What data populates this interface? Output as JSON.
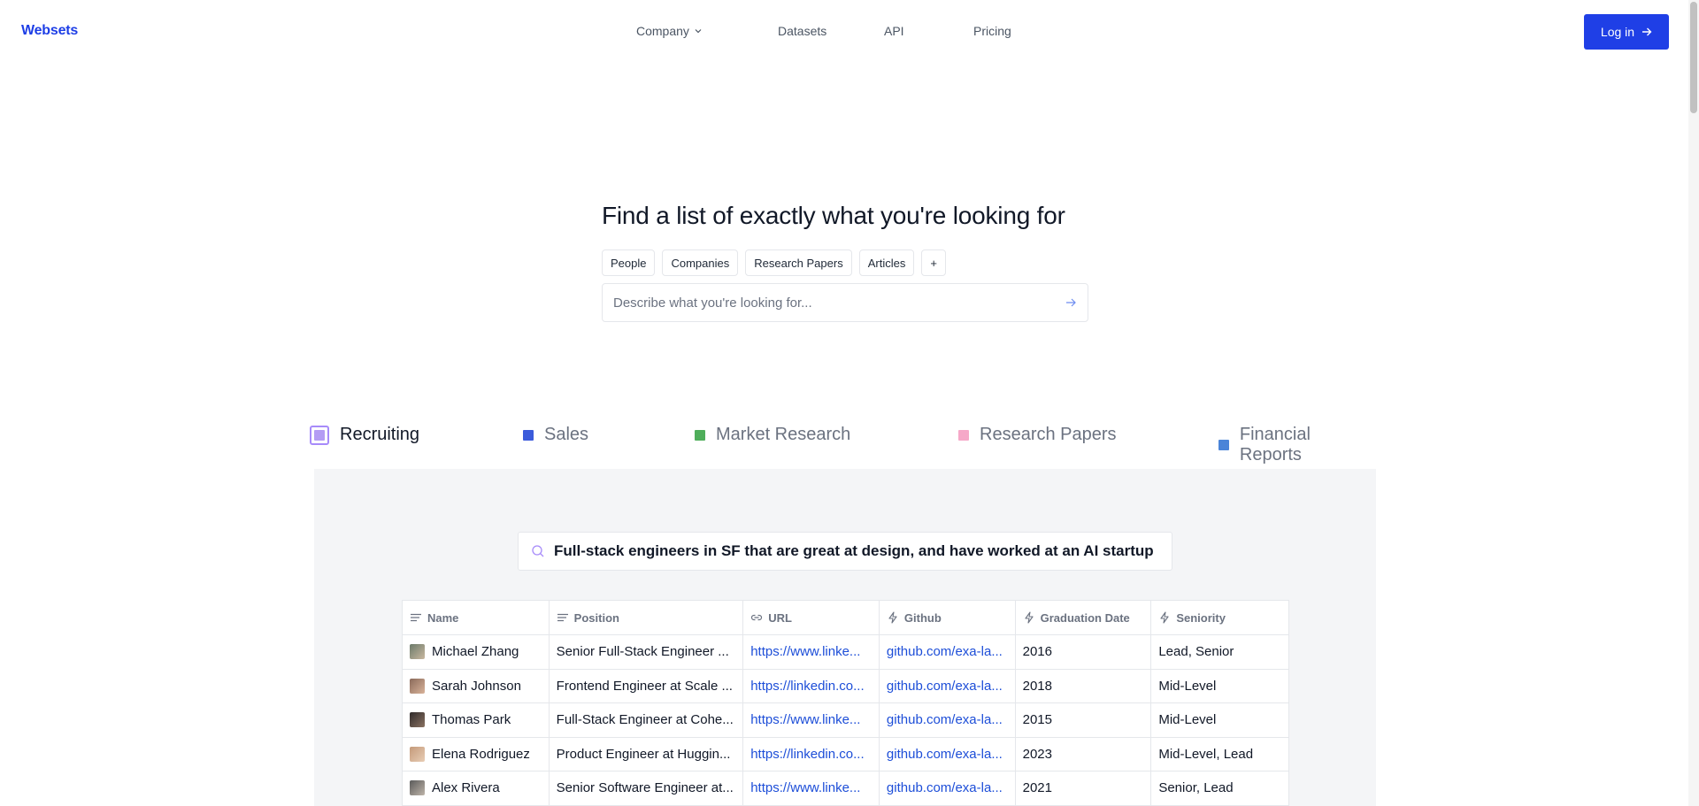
{
  "nav": {
    "logo": "Websets",
    "links": [
      {
        "label": "Company",
        "has_dropdown": true
      },
      {
        "label": "Datasets"
      },
      {
        "label": "API"
      },
      {
        "label": "Pricing"
      }
    ],
    "login_label": "Log in"
  },
  "hero": {
    "title": "Find a list of exactly what you're looking for",
    "chips": [
      "People",
      "Companies",
      "Research Papers",
      "Articles",
      "+"
    ],
    "search_placeholder": "Describe what you're looking for..."
  },
  "tabs": [
    {
      "label": "Recruiting",
      "color": "#b49cf4",
      "active": true
    },
    {
      "label": "Sales",
      "color": "#3b5bdb"
    },
    {
      "label": "Market Research",
      "color": "#4fae5b"
    },
    {
      "label": "Research Papers",
      "color": "#f6a8c8"
    },
    {
      "label": "Financial Reports",
      "color": "#4a84d8"
    }
  ],
  "demo": {
    "query": "Full-stack engineers in SF that are great at design, and have worked at an AI startup",
    "columns": [
      {
        "label": "Name",
        "icon": "text-lines-icon"
      },
      {
        "label": "Position",
        "icon": "text-lines-icon"
      },
      {
        "label": "URL",
        "icon": "link-icon"
      },
      {
        "label": "Github",
        "icon": "bolt-icon"
      },
      {
        "label": "Graduation Date",
        "icon": "bolt-icon"
      },
      {
        "label": "Seniority",
        "icon": "bolt-icon"
      }
    ],
    "rows": [
      {
        "name": "Michael Zhang",
        "position": "Senior Full-Stack Engineer ...",
        "url": "https://www.linke...",
        "github": "github.com/exa-la...",
        "graduation": "2016",
        "seniority": "Lead, Senior"
      },
      {
        "name": "Sarah Johnson",
        "position": "Frontend Engineer at Scale ...",
        "url": "https://linkedin.co...",
        "github": "github.com/exa-la...",
        "graduation": "2018",
        "seniority": "Mid-Level"
      },
      {
        "name": "Thomas Park",
        "position": "Full-Stack Engineer at Cohe...",
        "url": "https://www.linke...",
        "github": "github.com/exa-la...",
        "graduation": "2015",
        "seniority": "Mid-Level"
      },
      {
        "name": "Elena Rodriguez",
        "position": "Product Engineer at Huggin...",
        "url": "https://linkedin.co...",
        "github": "github.com/exa-la...",
        "graduation": "2023",
        "seniority": "Mid-Level, Lead"
      },
      {
        "name": "Alex Rivera",
        "position": "Senior Software Engineer at...",
        "url": "https://www.linke...",
        "github": "github.com/exa-la...",
        "graduation": "2021",
        "seniority": "Senior, Lead"
      }
    ]
  }
}
